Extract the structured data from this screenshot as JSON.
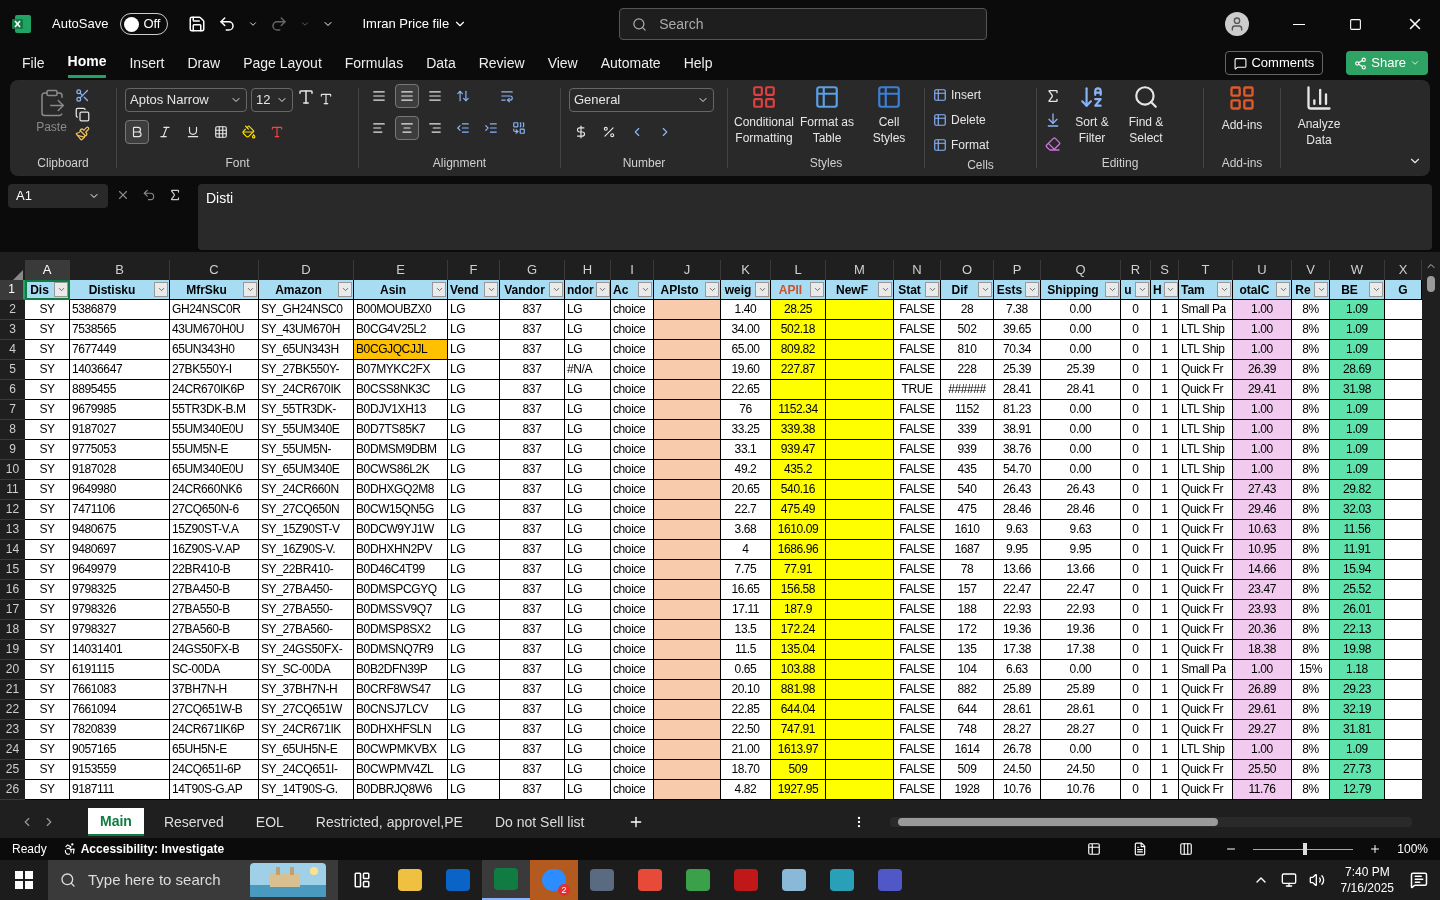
{
  "title_bar": {
    "autosave_label": "AutoSave",
    "autosave": {
      "on": false,
      "state_label": "Off"
    },
    "file_name": "Imran Price file",
    "search": {
      "placeholder": "Search"
    }
  },
  "menu_tabs": [
    {
      "label": "File",
      "selected": false
    },
    {
      "label": "Home",
      "selected": true
    },
    {
      "label": "Insert",
      "selected": false
    },
    {
      "label": "Draw",
      "selected": false
    },
    {
      "label": "Page Layout",
      "selected": false
    },
    {
      "label": "Formulas",
      "selected": false
    },
    {
      "label": "Data",
      "selected": false
    },
    {
      "label": "Review",
      "selected": false
    },
    {
      "label": "View",
      "selected": false
    },
    {
      "label": "Automate",
      "selected": false
    },
    {
      "label": "Help",
      "selected": false
    }
  ],
  "actions": {
    "comments": "Comments",
    "share": "Share"
  },
  "ribbon": {
    "clipboard": {
      "title": "Clipboard",
      "paste": "Paste"
    },
    "font": {
      "title": "Font",
      "family": "Aptos Narrow",
      "size": "12",
      "bold": true
    },
    "alignment": {
      "title": "Alignment",
      "middle": true,
      "center": true
    },
    "number": {
      "title": "Number",
      "format": "General"
    },
    "styles": {
      "title": "Styles",
      "buttons": [
        "Conditional Formatting",
        "Format as Table",
        "Cell Styles"
      ]
    },
    "cells": {
      "title": "Cells",
      "buttons": [
        "Insert",
        "Delete",
        "Format"
      ]
    },
    "editing": {
      "title": "Editing",
      "buttons": [
        "Sort & Filter",
        "Find & Select"
      ]
    },
    "addins": {
      "title": "Add-ins",
      "button": "Add-ins"
    },
    "analyze": {
      "button": "Analyze Data"
    }
  },
  "formula_bar": {
    "name_box": "A1",
    "content": "Disti"
  },
  "sheet": {
    "header_row": {
      "num": "1",
      "selected": true
    },
    "columns": [
      {
        "letter": "A",
        "header": "Dis",
        "selected": true
      },
      {
        "letter": "B",
        "header": "Distisku",
        "selected": false
      },
      {
        "letter": "C",
        "header": "MfrSku",
        "selected": false
      },
      {
        "letter": "D",
        "header": "Amazon",
        "selected": false
      },
      {
        "letter": "E",
        "header": "Asin",
        "selected": false
      },
      {
        "letter": "F",
        "header": "Vend",
        "selected": false
      },
      {
        "letter": "G",
        "header": "Vandor",
        "selected": false
      },
      {
        "letter": "H",
        "header": "ndor",
        "selected": false
      },
      {
        "letter": "I",
        "header": "Ac",
        "selected": false
      },
      {
        "letter": "J",
        "header": "APIsto",
        "selected": false,
        "color": "#f8cbad"
      },
      {
        "letter": "K",
        "header": "weig",
        "selected": false
      },
      {
        "letter": "L",
        "header": "APII",
        "selected": false,
        "color": "#ffff00",
        "accent": true
      },
      {
        "letter": "M",
        "header": "NewF",
        "selected": false,
        "color": "#ffff00"
      },
      {
        "letter": "N",
        "header": "Stat",
        "selected": false
      },
      {
        "letter": "O",
        "header": "Dif",
        "selected": false
      },
      {
        "letter": "P",
        "header": "Ests",
        "selected": false
      },
      {
        "letter": "Q",
        "header": "Shipping",
        "selected": false
      },
      {
        "letter": "R",
        "header": "u",
        "selected": false
      },
      {
        "letter": "S",
        "header": "H",
        "selected": false
      },
      {
        "letter": "T",
        "header": "Tam",
        "selected": false
      },
      {
        "letter": "U",
        "header": "otalC",
        "selected": false,
        "color": "#f2c9ef"
      },
      {
        "letter": "V",
        "header": "Re",
        "selected": false
      },
      {
        "letter": "W",
        "header": "BE",
        "selected": false,
        "color": "#5fe3ac"
      },
      {
        "letter": "X",
        "header": "G",
        "selected": false
      }
    ],
    "rows": [
      {
        "num": "2",
        "cells": [
          "SY",
          "5386879",
          "GH24NSC0R",
          "SY_GH24NSC0",
          "B00MOUBZX0",
          "LG",
          "837",
          "LG",
          "choice",
          null,
          "1.40",
          "28.25",
          null,
          "FALSE",
          "28",
          "7.38",
          "0.00",
          "0",
          "1",
          "Small Pa",
          "1.00",
          "8%",
          "1.09"
        ]
      },
      {
        "num": "3",
        "cells": [
          "SY",
          "7538565",
          "43UM670H0U",
          "SY_43UM670H",
          "B0CG4V25L2",
          "LG",
          "837",
          "LG",
          "choice",
          null,
          "34.00",
          "502.18",
          null,
          "FALSE",
          "502",
          "39.65",
          "0.00",
          "0",
          "1",
          "LTL Ship",
          "1.00",
          "8%",
          "1.09"
        ]
      },
      {
        "num": "4",
        "cells": [
          "SY",
          "7677449",
          "65UN343H0",
          "SY_65UN343H",
          {
            "text": "B0CGJQCJJL",
            "color": "#ffc000"
          },
          "LG",
          "837",
          "LG",
          "choice",
          null,
          "65.00",
          "809.82",
          null,
          "FALSE",
          "810",
          "70.34",
          "0.00",
          "0",
          "1",
          "LTL Ship",
          "1.00",
          "8%",
          "1.09"
        ]
      },
      {
        "num": "5",
        "cells": [
          "SY",
          "14036647",
          "27BK550Y-I",
          "SY_27BK550Y-",
          "B07MYKC2FX",
          "LG",
          "837",
          "#N/A",
          "choice",
          null,
          "19.60",
          "227.87",
          null,
          "FALSE",
          "228",
          "25.39",
          "25.39",
          "0",
          "1",
          "Quick Fr",
          "26.39",
          "8%",
          "28.69"
        ]
      },
      {
        "num": "6",
        "cells": [
          "SY",
          "8895455",
          "24CR670IK6P",
          "SY_24CR670IK",
          "B0CSS8NK3C",
          "LG",
          "837",
          "LG",
          "choice",
          null,
          "22.65",
          null,
          null,
          "TRUE",
          "######",
          "28.41",
          "28.41",
          "0",
          "1",
          "Quick Fr",
          "29.41",
          "8%",
          "31.98"
        ]
      },
      {
        "num": "7",
        "cells": [
          "SY",
          "9679985",
          "55TR3DK-B.M",
          "SY_55TR3DK-",
          "B0DJV1XH13",
          "LG",
          "837",
          "LG",
          "choice",
          null,
          "76",
          "1152.34",
          null,
          "FALSE",
          "1152",
          "81.23",
          "0.00",
          "0",
          "1",
          "LTL Ship",
          "1.00",
          "8%",
          "1.09"
        ]
      },
      {
        "num": "8",
        "cells": [
          "SY",
          "9187027",
          "55UM340E0U",
          "SY_55UM340E",
          "B0D7TS85K7",
          "LG",
          "837",
          "LG",
          "choice",
          null,
          "33.25",
          "339.38",
          null,
          "FALSE",
          "339",
          "38.91",
          "0.00",
          "0",
          "1",
          "LTL Ship",
          "1.00",
          "8%",
          "1.09"
        ]
      },
      {
        "num": "9",
        "cells": [
          "SY",
          "9775053",
          "55UM5N-E",
          "SY_55UM5N-",
          "B0DMSM9DBM",
          "LG",
          "837",
          "LG",
          "choice",
          null,
          "33.1",
          "939.47",
          null,
          "FALSE",
          "939",
          "38.76",
          "0.00",
          "0",
          "1",
          "LTL Ship",
          "1.00",
          "8%",
          "1.09"
        ]
      },
      {
        "num": "10",
        "cells": [
          "SY",
          "9187028",
          "65UM340E0U",
          "SY_65UM340E",
          "B0CWS86L2K",
          "LG",
          "837",
          "LG",
          "choice",
          null,
          "49.2",
          "435.2",
          null,
          "FALSE",
          "435",
          "54.70",
          "0.00",
          "0",
          "1",
          "LTL Ship",
          "1.00",
          "8%",
          "1.09"
        ]
      },
      {
        "num": "11",
        "cells": [
          "SY",
          "9649980",
          "24CR660NK6",
          "SY_24CR660N",
          "B0DHXGQ2M8",
          "LG",
          "837",
          "LG",
          "choice",
          null,
          "20.65",
          "540.16",
          null,
          "FALSE",
          "540",
          "26.43",
          "26.43",
          "0",
          "1",
          "Quick Fr",
          "27.43",
          "8%",
          "29.82"
        ]
      },
      {
        "num": "12",
        "cells": [
          "SY",
          "7471106",
          "27CQ650N-6",
          "SY_27CQ650N",
          "B0CW15QN5G",
          "LG",
          "837",
          "LG",
          "choice",
          null,
          "22.7",
          "475.49",
          null,
          "FALSE",
          "475",
          "28.46",
          "28.46",
          "0",
          "1",
          "Quick Fr",
          "29.46",
          "8%",
          "32.03"
        ]
      },
      {
        "num": "13",
        "cells": [
          "SY",
          "9480675",
          "15Z90ST-V.A",
          "SY_15Z90ST-V",
          "B0DCW9YJ1W",
          "LG",
          "837",
          "LG",
          "choice",
          null,
          "3.68",
          "1610.09",
          null,
          "FALSE",
          "1610",
          "9.63",
          "9.63",
          "0",
          "1",
          "Quick Fr",
          "10.63",
          "8%",
          "11.56"
        ]
      },
      {
        "num": "14",
        "cells": [
          "SY",
          "9480697",
          "16Z90S-V.AP",
          "SY_16Z90S-V.",
          "B0DHXHN2PV",
          "LG",
          "837",
          "LG",
          "choice",
          null,
          "4",
          "1686.96",
          null,
          "FALSE",
          "1687",
          "9.95",
          "9.95",
          "0",
          "1",
          "Quick Fr",
          "10.95",
          "8%",
          "11.91"
        ]
      },
      {
        "num": "15",
        "cells": [
          "SY",
          "9649979",
          "22BR410-B",
          "SY_22BR410-",
          "B0D46C4T99",
          "LG",
          "837",
          "LG",
          "choice",
          null,
          "7.75",
          "77.91",
          null,
          "FALSE",
          "78",
          "13.66",
          "13.66",
          "0",
          "1",
          "Quick Fr",
          "14.66",
          "8%",
          "15.94"
        ]
      },
      {
        "num": "16",
        "cells": [
          "SY",
          "9798325",
          "27BA450-B",
          "SY_27BA450-",
          "B0DMSPCGYQ",
          "LG",
          "837",
          "LG",
          "choice",
          null,
          "16.65",
          "156.58",
          null,
          "FALSE",
          "157",
          "22.47",
          "22.47",
          "0",
          "1",
          "Quick Fr",
          "23.47",
          "8%",
          "25.52"
        ]
      },
      {
        "num": "17",
        "cells": [
          "SY",
          "9798326",
          "27BA550-B",
          "SY_27BA550-",
          "B0DMSSV9Q7",
          "LG",
          "837",
          "LG",
          "choice",
          null,
          "17.11",
          "187.9",
          null,
          "FALSE",
          "188",
          "22.93",
          "22.93",
          "0",
          "1",
          "Quick Fr",
          "23.93",
          "8%",
          "26.01"
        ]
      },
      {
        "num": "18",
        "cells": [
          "SY",
          "9798327",
          "27BA560-B",
          "SY_27BA560-",
          "B0DMSP8SX2",
          "LG",
          "837",
          "LG",
          "choice",
          null,
          "13.5",
          "172.24",
          null,
          "FALSE",
          "172",
          "19.36",
          "19.36",
          "0",
          "1",
          "Quick Fr",
          "20.36",
          "8%",
          "22.13"
        ]
      },
      {
        "num": "19",
        "cells": [
          "SY",
          "14031401",
          "24GS50FX-B",
          "SY_24GS50FX-",
          "B0DMSNQ7R9",
          "LG",
          "837",
          "LG",
          "choice",
          null,
          "11.5",
          "135.04",
          null,
          "FALSE",
          "135",
          "17.38",
          "17.38",
          "0",
          "1",
          "Quick Fr",
          "18.38",
          "8%",
          "19.98"
        ]
      },
      {
        "num": "20",
        "cells": [
          "SY",
          "6191115",
          "SC-00DA",
          "SY_SC-00DA",
          "B0B2DFN39P",
          "LG",
          "837",
          "LG",
          "choice",
          null,
          "0.65",
          "103.88",
          null,
          "FALSE",
          "104",
          "6.63",
          "0.00",
          "0",
          "1",
          "Small Pa",
          "1.00",
          "15%",
          "1.18"
        ]
      },
      {
        "num": "21",
        "cells": [
          "SY",
          "7661083",
          "37BH7N-H",
          "SY_37BH7N-H",
          "B0CRF8WS47",
          "LG",
          "837",
          "LG",
          "choice",
          null,
          "20.10",
          "881.98",
          null,
          "FALSE",
          "882",
          "25.89",
          "25.89",
          "0",
          "1",
          "Quick Fr",
          "26.89",
          "8%",
          "29.23"
        ]
      },
      {
        "num": "22",
        "cells": [
          "SY",
          "7661094",
          "27CQ651W-B",
          "SY_27CQ651W",
          "B0CNSJ7LCV",
          "LG",
          "837",
          "LG",
          "choice",
          null,
          "22.85",
          "644.04",
          null,
          "FALSE",
          "644",
          "28.61",
          "28.61",
          "0",
          "1",
          "Quick Fr",
          "29.61",
          "8%",
          "32.19"
        ]
      },
      {
        "num": "23",
        "cells": [
          "SY",
          "7820839",
          "24CR671IK6P",
          "SY_24CR671IK",
          "B0DHXHFSLN",
          "LG",
          "837",
          "LG",
          "choice",
          null,
          "22.50",
          "747.91",
          null,
          "FALSE",
          "748",
          "28.27",
          "28.27",
          "0",
          "1",
          "Quick Fr",
          "29.27",
          "8%",
          "31.81"
        ]
      },
      {
        "num": "24",
        "cells": [
          "SY",
          "9057165",
          "65UH5N-E",
          "SY_65UH5N-E",
          "B0CWPMKVBX",
          "LG",
          "837",
          "LG",
          "choice",
          null,
          "21.00",
          "1613.97",
          null,
          "FALSE",
          "1614",
          "26.78",
          "0.00",
          "0",
          "1",
          "LTL Ship",
          "1.00",
          "8%",
          "1.09"
        ]
      },
      {
        "num": "25",
        "cells": [
          "SY",
          "9153559",
          "24CQ651I-6P",
          "SY_24CQ651I-",
          "B0CWPMV4ZL",
          "LG",
          "837",
          "LG",
          "choice",
          null,
          "18.70",
          "509",
          null,
          "FALSE",
          "509",
          "24.50",
          "24.50",
          "0",
          "1",
          "Quick Fr",
          "25.50",
          "8%",
          "27.73"
        ]
      },
      {
        "num": "26",
        "cells": [
          "SY",
          "9187111",
          "14T90S-G.AP",
          "SY_14T90S-G.",
          "B0DBRJQ8W6",
          "LG",
          "837",
          "LG",
          "choice",
          null,
          "4.82",
          "1927.95",
          null,
          "FALSE",
          "1928",
          "10.76",
          "10.76",
          "0",
          "1",
          "Quick Fr",
          "11.76",
          "8%",
          "12.79"
        ]
      }
    ]
  },
  "sheet_tabs": [
    {
      "label": "Main",
      "selected": true
    },
    {
      "label": "Reserved",
      "selected": false
    },
    {
      "label": "EOL",
      "selected": false
    },
    {
      "label": "Restricted, approvel,PE",
      "selected": false
    },
    {
      "label": "Do not Sell list",
      "selected": false
    }
  ],
  "status_bar": {
    "ready": "Ready",
    "accessibility": "Accessibility: Investigate",
    "zoom": {
      "level": 0.5
    },
    "zoom_label": "100%"
  },
  "taskbar": {
    "search_placeholder": "Type here to search",
    "zoom_badge": "2",
    "time": "7:40 PM",
    "date": "7/16/2025"
  }
}
